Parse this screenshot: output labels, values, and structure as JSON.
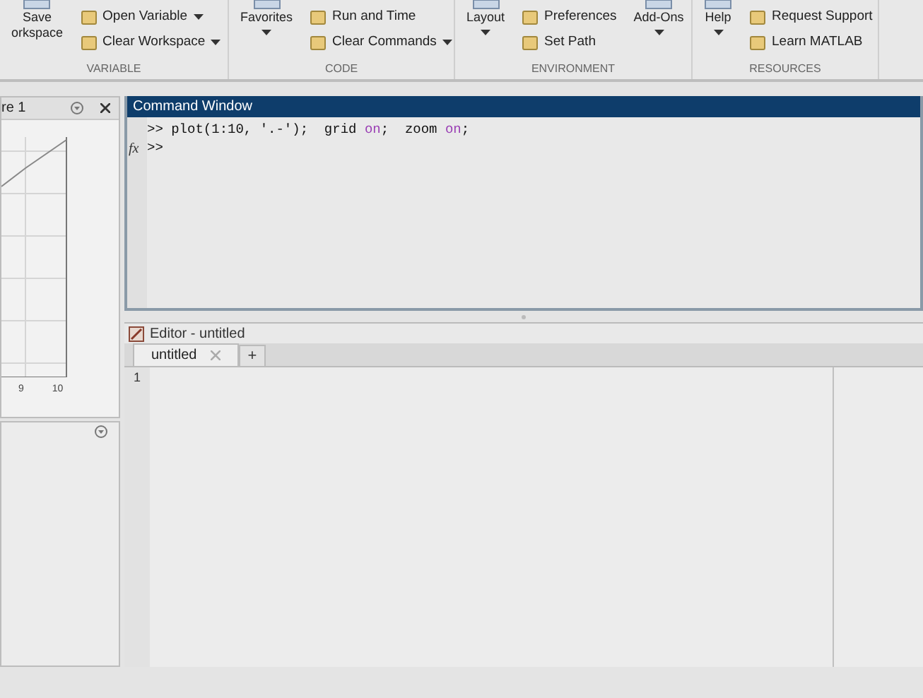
{
  "toolstrip": {
    "sections": [
      {
        "label": "VARIABLE",
        "columns": [
          [
            {
              "kind": "large",
              "lines": [
                "Save",
                "orkspace"
              ],
              "dropdown": false
            }
          ],
          [
            {
              "kind": "small",
              "lines": [
                "Open Variable"
              ],
              "dropdown": true
            },
            {
              "kind": "small",
              "lines": [
                "Clear Workspace"
              ],
              "dropdown": true
            }
          ]
        ]
      },
      {
        "label": "CODE",
        "columns": [
          [
            {
              "kind": "large",
              "lines": [
                "Favorites"
              ],
              "dropdown": true
            }
          ],
          [
            {
              "kind": "small",
              "lines": [
                "Run and Time"
              ],
              "dropdown": false
            },
            {
              "kind": "small",
              "lines": [
                "Clear Commands"
              ],
              "dropdown": true
            }
          ]
        ]
      },
      {
        "label": "ENVIRONMENT",
        "columns": [
          [
            {
              "kind": "large",
              "lines": [
                "Layout"
              ],
              "dropdown": true
            }
          ],
          [
            {
              "kind": "small",
              "lines": [
                "Preferences"
              ],
              "dropdown": false
            },
            {
              "kind": "small",
              "lines": [
                "Set Path"
              ],
              "dropdown": false
            }
          ],
          [
            {
              "kind": "large",
              "lines": [
                "Add-Ons"
              ],
              "dropdown": true
            }
          ]
        ]
      },
      {
        "label": "RESOURCES",
        "columns": [
          [
            {
              "kind": "large",
              "lines": [
                "Help"
              ],
              "dropdown": true
            }
          ],
          [
            {
              "kind": "small",
              "lines": [
                "Request Support"
              ],
              "dropdown": false
            },
            {
              "kind": "small",
              "lines": [
                "Learn MATLAB"
              ],
              "dropdown": false
            }
          ]
        ]
      }
    ]
  },
  "figure_panel": {
    "title": "re 1",
    "tick_labels": [
      "9",
      "10"
    ]
  },
  "command_window": {
    "title": "Command Window",
    "lines": [
      {
        "prompt": ">>",
        "segments": [
          {
            "kind": "code",
            "text": "plot(1:10, '.-');  grid "
          },
          {
            "kind": "keyword",
            "text": "on"
          },
          {
            "kind": "code",
            "text": ";  zoom "
          },
          {
            "kind": "keyword",
            "text": "on"
          },
          {
            "kind": "code",
            "text": ";"
          }
        ]
      },
      {
        "prompt": ">>",
        "marker": "fx"
      }
    ]
  },
  "editor": {
    "title": "Editor - untitled",
    "tabs": [
      {
        "label": "untitled",
        "selected": true
      }
    ],
    "add_tab": "+",
    "line_numbers": [
      "1"
    ]
  }
}
